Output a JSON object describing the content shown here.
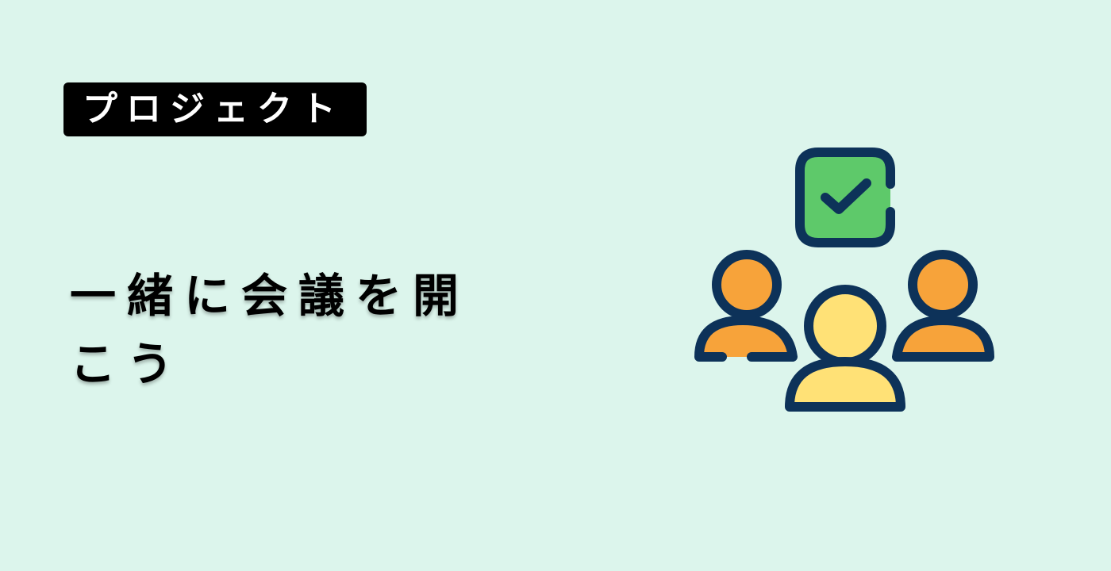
{
  "category_tag": {
    "label": "プロジェクト"
  },
  "headline": {
    "text": "一緒に会議を開こう"
  },
  "illustration": {
    "icon": "team-meeting-checkmark",
    "colors": {
      "outline": "#0d3259",
      "checkbox_fill": "#5ec96a",
      "side_people_fill": "#f7a33a",
      "center_person_fill": "#ffe176"
    }
  }
}
